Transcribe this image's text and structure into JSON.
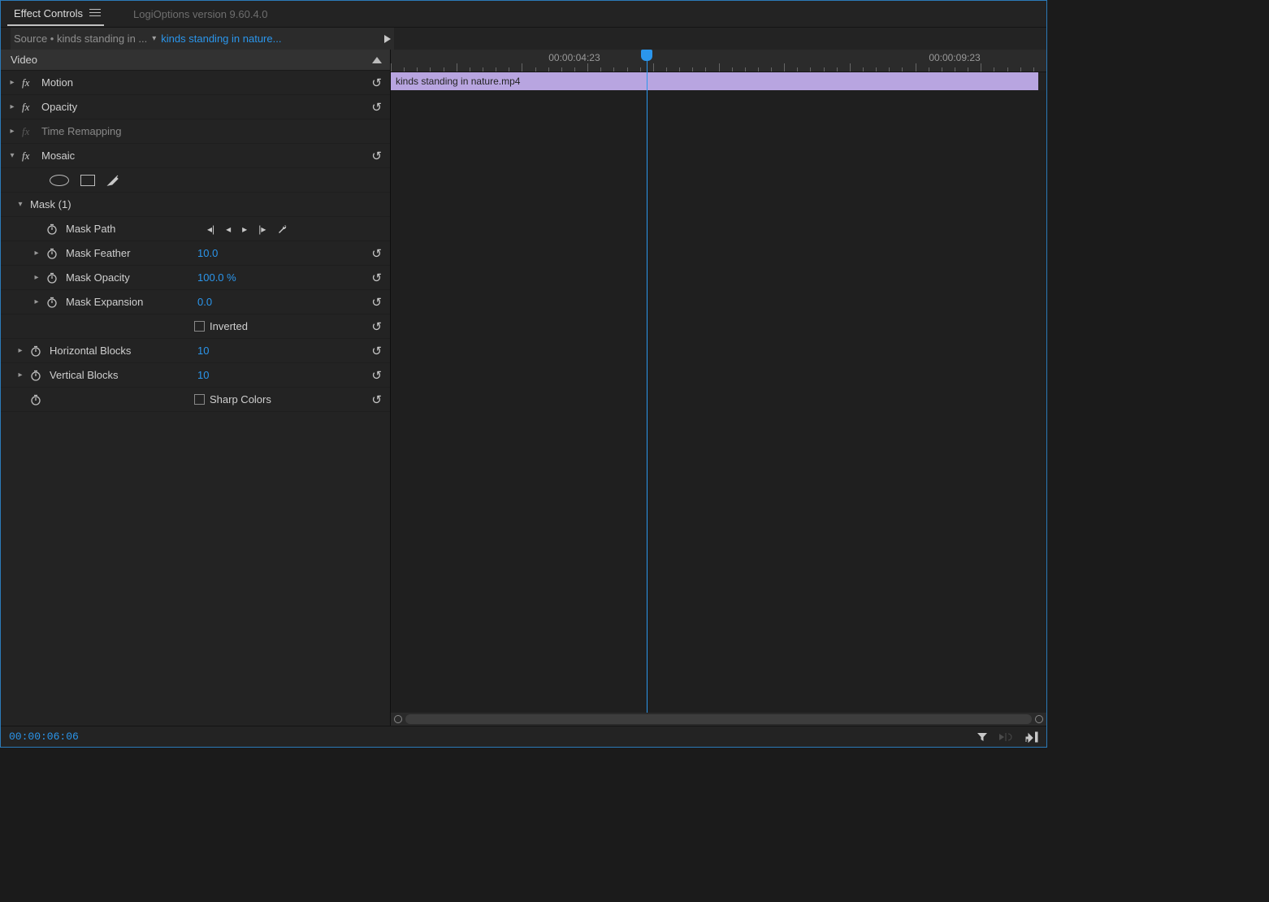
{
  "tabs": {
    "active_label": "Effect Controls",
    "inactive_label": "LogiOptions version 9.60.4.0"
  },
  "source": {
    "label": "Source • kinds standing in ...",
    "sequence": "kinds standing in nature..."
  },
  "video_header": "Video",
  "effects": {
    "motion": "Motion",
    "opacity": "Opacity",
    "time_remapping": "Time Remapping",
    "mosaic": "Mosaic"
  },
  "mask": {
    "header": "Mask (1)",
    "path": "Mask Path",
    "feather_label": "Mask Feather",
    "feather_value": "10.0",
    "opacity_label": "Mask Opacity",
    "opacity_value": "100.0 %",
    "expansion_label": "Mask Expansion",
    "expansion_value": "0.0",
    "inverted": "Inverted"
  },
  "mosaic_props": {
    "hblocks_label": "Horizontal Blocks",
    "hblocks_value": "10",
    "vblocks_label": "Vertical Blocks",
    "vblocks_value": "10",
    "sharp_colors": "Sharp Colors"
  },
  "timeline": {
    "clip_name": "kinds standing in nature.mp4",
    "ruler_labels": [
      "00:00:04:23",
      "00:00:09:23"
    ],
    "ruler_positions_pct": [
      28,
      86
    ]
  },
  "playhead_pct": 39,
  "current_time": "00:00:06:06"
}
